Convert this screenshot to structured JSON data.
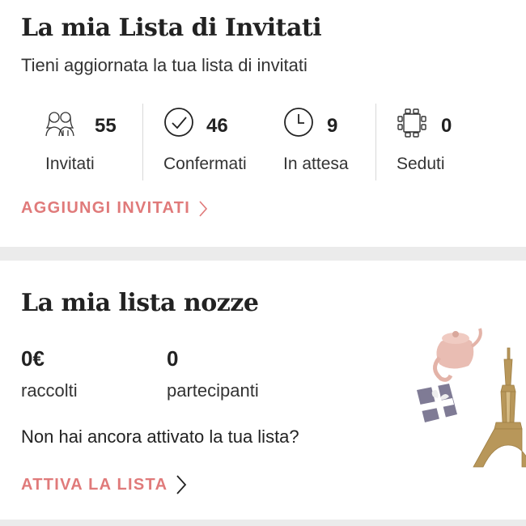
{
  "guests": {
    "title": "La mia Lista di Invitati",
    "subtitle": "Tieni aggiornata la tua lista di invitati",
    "stats": [
      {
        "value": "55",
        "label": "Invitati",
        "icon": "guests-icon"
      },
      {
        "value": "46",
        "label": "Confermati",
        "icon": "check-circle-icon"
      },
      {
        "value": "9",
        "label": "In attesa",
        "icon": "clock-icon"
      },
      {
        "value": "0",
        "label": "Seduti",
        "icon": "table-seats-icon"
      }
    ],
    "cta": "AGGIUNGI INVITATI"
  },
  "registry": {
    "title": "La mia lista nozze",
    "collected_value": "0€",
    "collected_label": "raccolti",
    "participants_value": "0",
    "participants_label": "partecipanti",
    "question": "Non hai ancora attivato la tua lista?",
    "cta": "ATTIVA LA LISTA"
  },
  "colors": {
    "accent": "#e07a7a",
    "card": "#ffffff",
    "background": "#ebebeb",
    "text": "#222222"
  }
}
